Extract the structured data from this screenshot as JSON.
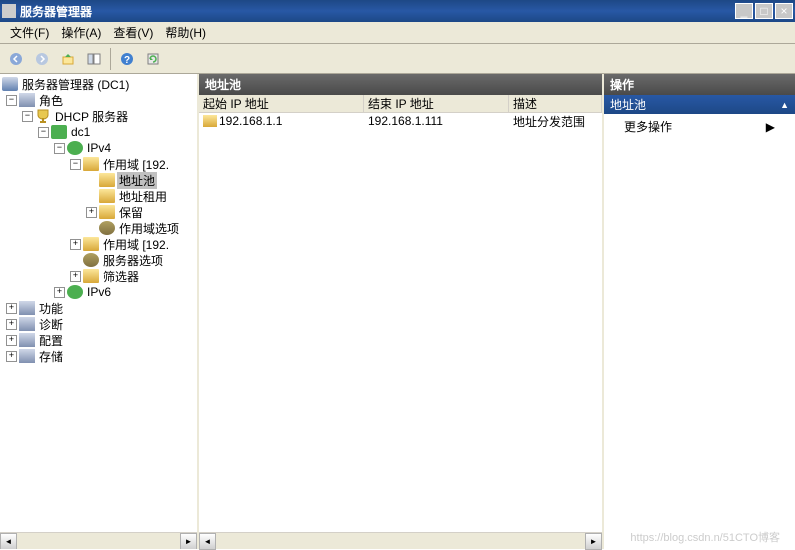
{
  "window": {
    "title": "服务器管理器"
  },
  "menu": {
    "file": "文件(F)",
    "action": "操作(A)",
    "view": "查看(V)",
    "help": "帮助(H)"
  },
  "tree": {
    "root": "服务器管理器 (DC1)",
    "roles": "角色",
    "dhcp_server": "DHCP 服务器",
    "dc1": "dc1",
    "ipv4": "IPv4",
    "scope1": "作用域 [192.",
    "address_pool": "地址池",
    "address_lease": "地址租用",
    "reservation": "保留",
    "scope_options": "作用域选项",
    "scope2": "作用域 [192.",
    "server_options": "服务器选项",
    "filters": "筛选器",
    "ipv6": "IPv6",
    "features": "功能",
    "diagnostics": "诊断",
    "configuration": "配置",
    "storage": "存储"
  },
  "center": {
    "title": "地址池",
    "columns": {
      "start_ip": "起始 IP 地址",
      "end_ip": "结束 IP 地址",
      "description": "描述"
    },
    "rows": [
      {
        "start": "192.168.1.1",
        "end": "192.168.1.111",
        "desc": "地址分发范围"
      }
    ]
  },
  "actions": {
    "title": "操作",
    "section": "地址池",
    "more": "更多操作"
  },
  "watermark": "https://blog.csdn.n/51CTO博客"
}
